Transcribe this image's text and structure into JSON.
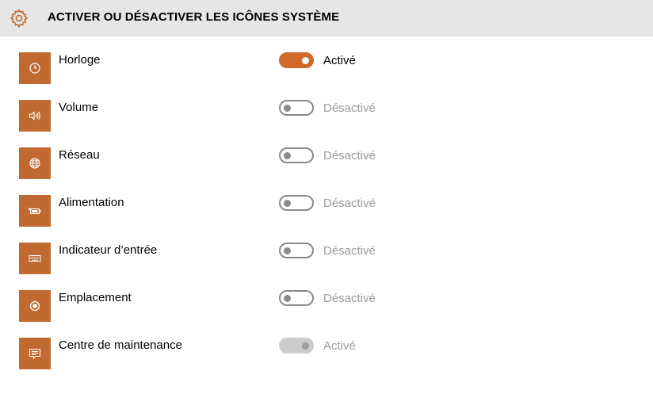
{
  "header": {
    "title": "ACTIVER OU DÉSACTIVER LES ICÔNES SYSTÈME",
    "icon": "gear-icon"
  },
  "colors": {
    "accent": "#c06a31",
    "toggle_on": "#d0692a",
    "header_bg": "#e6e6e6"
  },
  "items": [
    {
      "label": "Horloge",
      "icon": "clock-icon",
      "state_label": "Activé",
      "state": "on"
    },
    {
      "label": "Volume",
      "icon": "speaker-icon",
      "state_label": "Désactivé",
      "state": "off"
    },
    {
      "label": "Réseau",
      "icon": "globe-icon",
      "state_label": "Désactivé",
      "state": "off"
    },
    {
      "label": "Alimentation",
      "icon": "battery-icon",
      "state_label": "Désactivé",
      "state": "off"
    },
    {
      "label": "Indicateur d’entrée",
      "icon": "keyboard-icon",
      "state_label": "Désactivé",
      "state": "off"
    },
    {
      "label": "Emplacement",
      "icon": "location-icon",
      "state_label": "Désactivé",
      "state": "off"
    },
    {
      "label": "Centre de maintenance",
      "icon": "action-center-icon",
      "state_label": "Activé",
      "state": "disabled"
    }
  ]
}
